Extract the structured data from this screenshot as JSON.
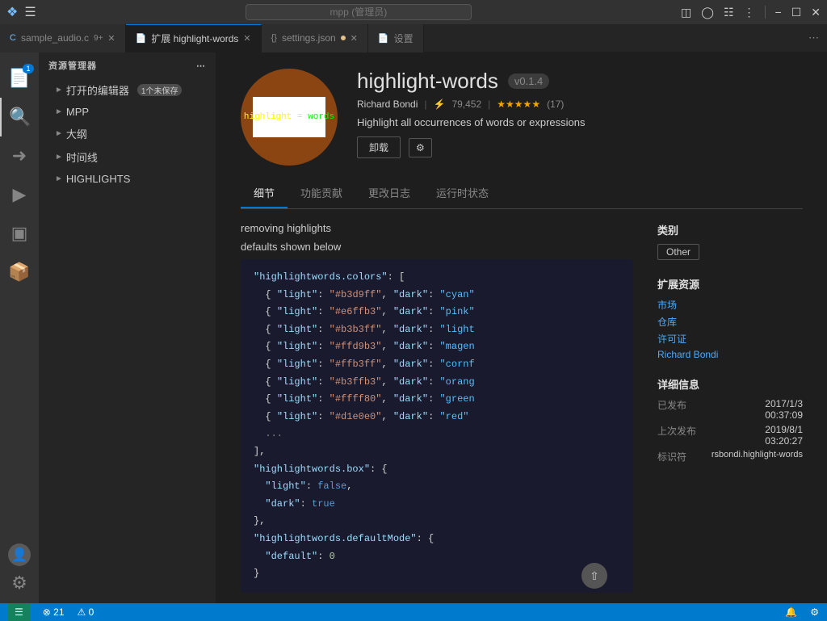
{
  "titlebar": {
    "search_placeholder": "mpp (管理员)",
    "window_controls": [
      "minimize",
      "maximize",
      "close"
    ]
  },
  "tabs": [
    {
      "id": "sample",
      "label": "sample_audio.c",
      "lang": "C",
      "modified": true,
      "badge": "9+",
      "active": false
    },
    {
      "id": "highlight-words",
      "label": "扩展 highlight-words",
      "active": true,
      "closable": true
    },
    {
      "id": "settings-json",
      "label": "settings.json",
      "modified": true
    },
    {
      "id": "settings",
      "label": "设置"
    }
  ],
  "sidebar": {
    "title": "资源管理器",
    "sections": [
      {
        "label": "打开的编辑器",
        "badge": "1个未保存"
      },
      {
        "label": "MPP"
      },
      {
        "label": "大纲"
      },
      {
        "label": "时间线"
      },
      {
        "label": "HIGHLIGHTS"
      }
    ]
  },
  "extension": {
    "name": "highlight-words",
    "version": "v0.1.4",
    "author": "Richard Bondi",
    "downloads": "79,452",
    "stars": "★★★★★",
    "star_count": "(17)",
    "description": "Highlight all occurrences of words or expressions",
    "logo_text": "highlight = words",
    "btn_uninstall": "卸载",
    "btn_gear": "⚙",
    "tabs": [
      "细节",
      "功能贡献",
      "更改日志",
      "运行时状态"
    ],
    "active_tab": "细节",
    "body": {
      "removing": "removing highlights",
      "defaults": "defaults shown below",
      "code": [
        "\"highlightwords.colors\": [",
        "  { \"light\": \"#b3d9ff\", \"dark\": \"cyan\"",
        "  { \"light\": \"#e6ffb3\", \"dark\": \"pink\"",
        "  { \"light\": \"#b3b3ff\", \"dark\": \"light",
        "  { \"light\": \"#ffd9b3\", \"dark\": \"magen",
        "  { \"light\": \"#ffb3ff\", \"dark\": \"cornf",
        "  { \"light\": \"#b3ffb3\", \"dark\": \"orang",
        "  { \"light\": \"#ffff80\", \"dark\": \"green",
        "  { \"light\": \"#d1e0e0\", \"dark\": \"red\"",
        "  ...",
        "],",
        "\"highlightwords.box\": {",
        "  \"light\": false,",
        "  \"dark\": true",
        "},",
        "\"highlightwords.defaultMode\": {",
        "  \"default\": 0",
        "}"
      ]
    },
    "right_sidebar": {
      "category_title": "类别",
      "category": "Other",
      "resources_title": "扩展资源",
      "links": [
        "市场",
        "仓库",
        "许可证"
      ],
      "author_link": "Richard Bondi",
      "details_title": "详细信息",
      "published_label": "已发布",
      "published_date": "2017/1/3",
      "published_time": "00:37:09",
      "last_updated_label": "上次发布",
      "last_updated_date": "2019/8/1",
      "last_updated_time": "03:20:27",
      "identifier_label": "标识符",
      "identifier": "rsbondi.highlight-words"
    }
  },
  "statusbar": {
    "errors": "⊗ 21",
    "warnings": "⚠ 0",
    "notifications_icon": "🔔",
    "settings_icon": "⚙"
  }
}
